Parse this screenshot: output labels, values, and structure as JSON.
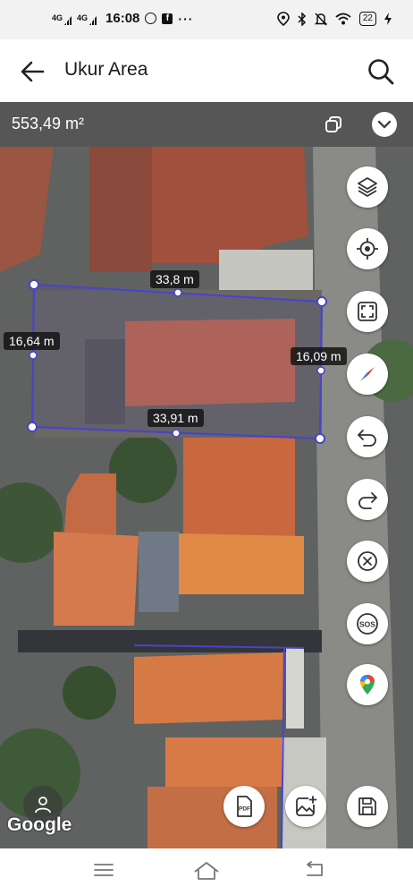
{
  "status_bar": {
    "sig1": "4G",
    "sig2": "4G",
    "time": "16:08",
    "more": "···",
    "battery": "22",
    "icons": [
      "whatsapp-icon",
      "facebook-icon",
      "location-icon",
      "bluetooth-icon",
      "mute-icon",
      "wifi-icon",
      "charging-icon"
    ]
  },
  "app_bar": {
    "title": "Ukur Area"
  },
  "area_bar": {
    "area": "553,49 m²"
  },
  "measure": {
    "top": "33,8 m",
    "left": "16,64 m",
    "right": "16,09 m",
    "bottom": "33,91 m"
  },
  "map_tools": [
    "layers-icon",
    "gps-target-icon",
    "fit-screen-icon",
    "compass-icon",
    "undo-icon",
    "redo-icon",
    "clear-icon",
    "sos-icon",
    "google-maps-icon",
    "save-icon"
  ],
  "map": {
    "attribution": "Google"
  },
  "bottom_tools": [
    "pdf-icon",
    "add-photo-icon"
  ],
  "colors": {
    "polygon": "#4a44c8",
    "area_bar": "#565656"
  }
}
